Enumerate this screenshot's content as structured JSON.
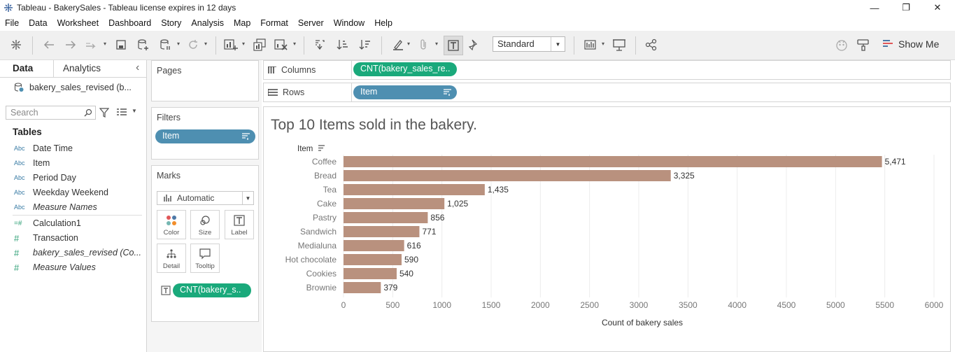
{
  "window": {
    "title": "Tableau - BakerySales - Tableau license expires in 12 days",
    "minimize": "—",
    "restore": "❐",
    "close": "✕"
  },
  "menu": [
    "File",
    "Data",
    "Worksheet",
    "Dashboard",
    "Story",
    "Analysis",
    "Map",
    "Format",
    "Server",
    "Window",
    "Help"
  ],
  "toolbar": {
    "fit_select": "Standard",
    "show_me": "Show Me"
  },
  "data_pane": {
    "tabs": [
      "Data",
      "Analytics"
    ],
    "collapse": "‹",
    "datasource": "bakery_sales_revised (b...",
    "search_placeholder": "Search",
    "tables_heading": "Tables",
    "fields": [
      {
        "type": "Abc",
        "label": "Date Time",
        "italic": false
      },
      {
        "type": "Abc",
        "label": "Item",
        "italic": false
      },
      {
        "type": "Abc",
        "label": "Period Day",
        "italic": false
      },
      {
        "type": "Abc",
        "label": "Weekday Weekend",
        "italic": false
      },
      {
        "type": "Abc",
        "label": "Measure Names",
        "italic": true
      },
      {
        "type": "=#",
        "label": "Calculation1",
        "italic": false
      },
      {
        "type": "#",
        "label": "Transaction",
        "italic": false
      },
      {
        "type": "#",
        "label": "bakery_sales_revised (Co...",
        "italic": true
      },
      {
        "type": "#",
        "label": "Measure Values",
        "italic": true
      }
    ]
  },
  "pages": {
    "title": "Pages"
  },
  "filters": {
    "title": "Filters",
    "pill": "Item"
  },
  "marks": {
    "title": "Marks",
    "mark_type": "Automatic",
    "buttons": [
      "Color",
      "Size",
      "Label",
      "Detail",
      "Tooltip"
    ],
    "pill": "CNT(bakery_s..",
    "colors": {
      "dots": [
        "#e15759",
        "#4e79a7",
        "#76b7b2",
        "#f28e2b"
      ]
    }
  },
  "columns_shelf": {
    "label": "Columns",
    "pill": "CNT(bakery_sales_re.."
  },
  "rows_shelf": {
    "label": "Rows",
    "pill": "Item"
  },
  "colors": {
    "bar": "#b9917e",
    "pill_green": "#1aa97b",
    "pill_blue": "#4e8fb1"
  },
  "chart_data": {
    "type": "bar",
    "orientation": "horizontal",
    "title": "Top  10 Items sold in the bakery.",
    "row_header": "Item",
    "xlabel": "Count of bakery sales",
    "xlim": [
      0,
      6000
    ],
    "xticks": [
      0,
      500,
      1000,
      1500,
      2000,
      2500,
      3000,
      3500,
      4000,
      4500,
      5000,
      5500,
      6000
    ],
    "categories": [
      "Coffee",
      "Bread",
      "Tea",
      "Cake",
      "Pastry",
      "Sandwich",
      "Medialuna",
      "Hot chocolate",
      "Cookies",
      "Brownie"
    ],
    "values": [
      5471,
      3325,
      1435,
      1025,
      856,
      771,
      616,
      590,
      540,
      379
    ],
    "value_labels": [
      "5,471",
      "3,325",
      "1,435",
      "1,025",
      "856",
      "771",
      "616",
      "590",
      "540",
      "379"
    ],
    "grid": true
  }
}
